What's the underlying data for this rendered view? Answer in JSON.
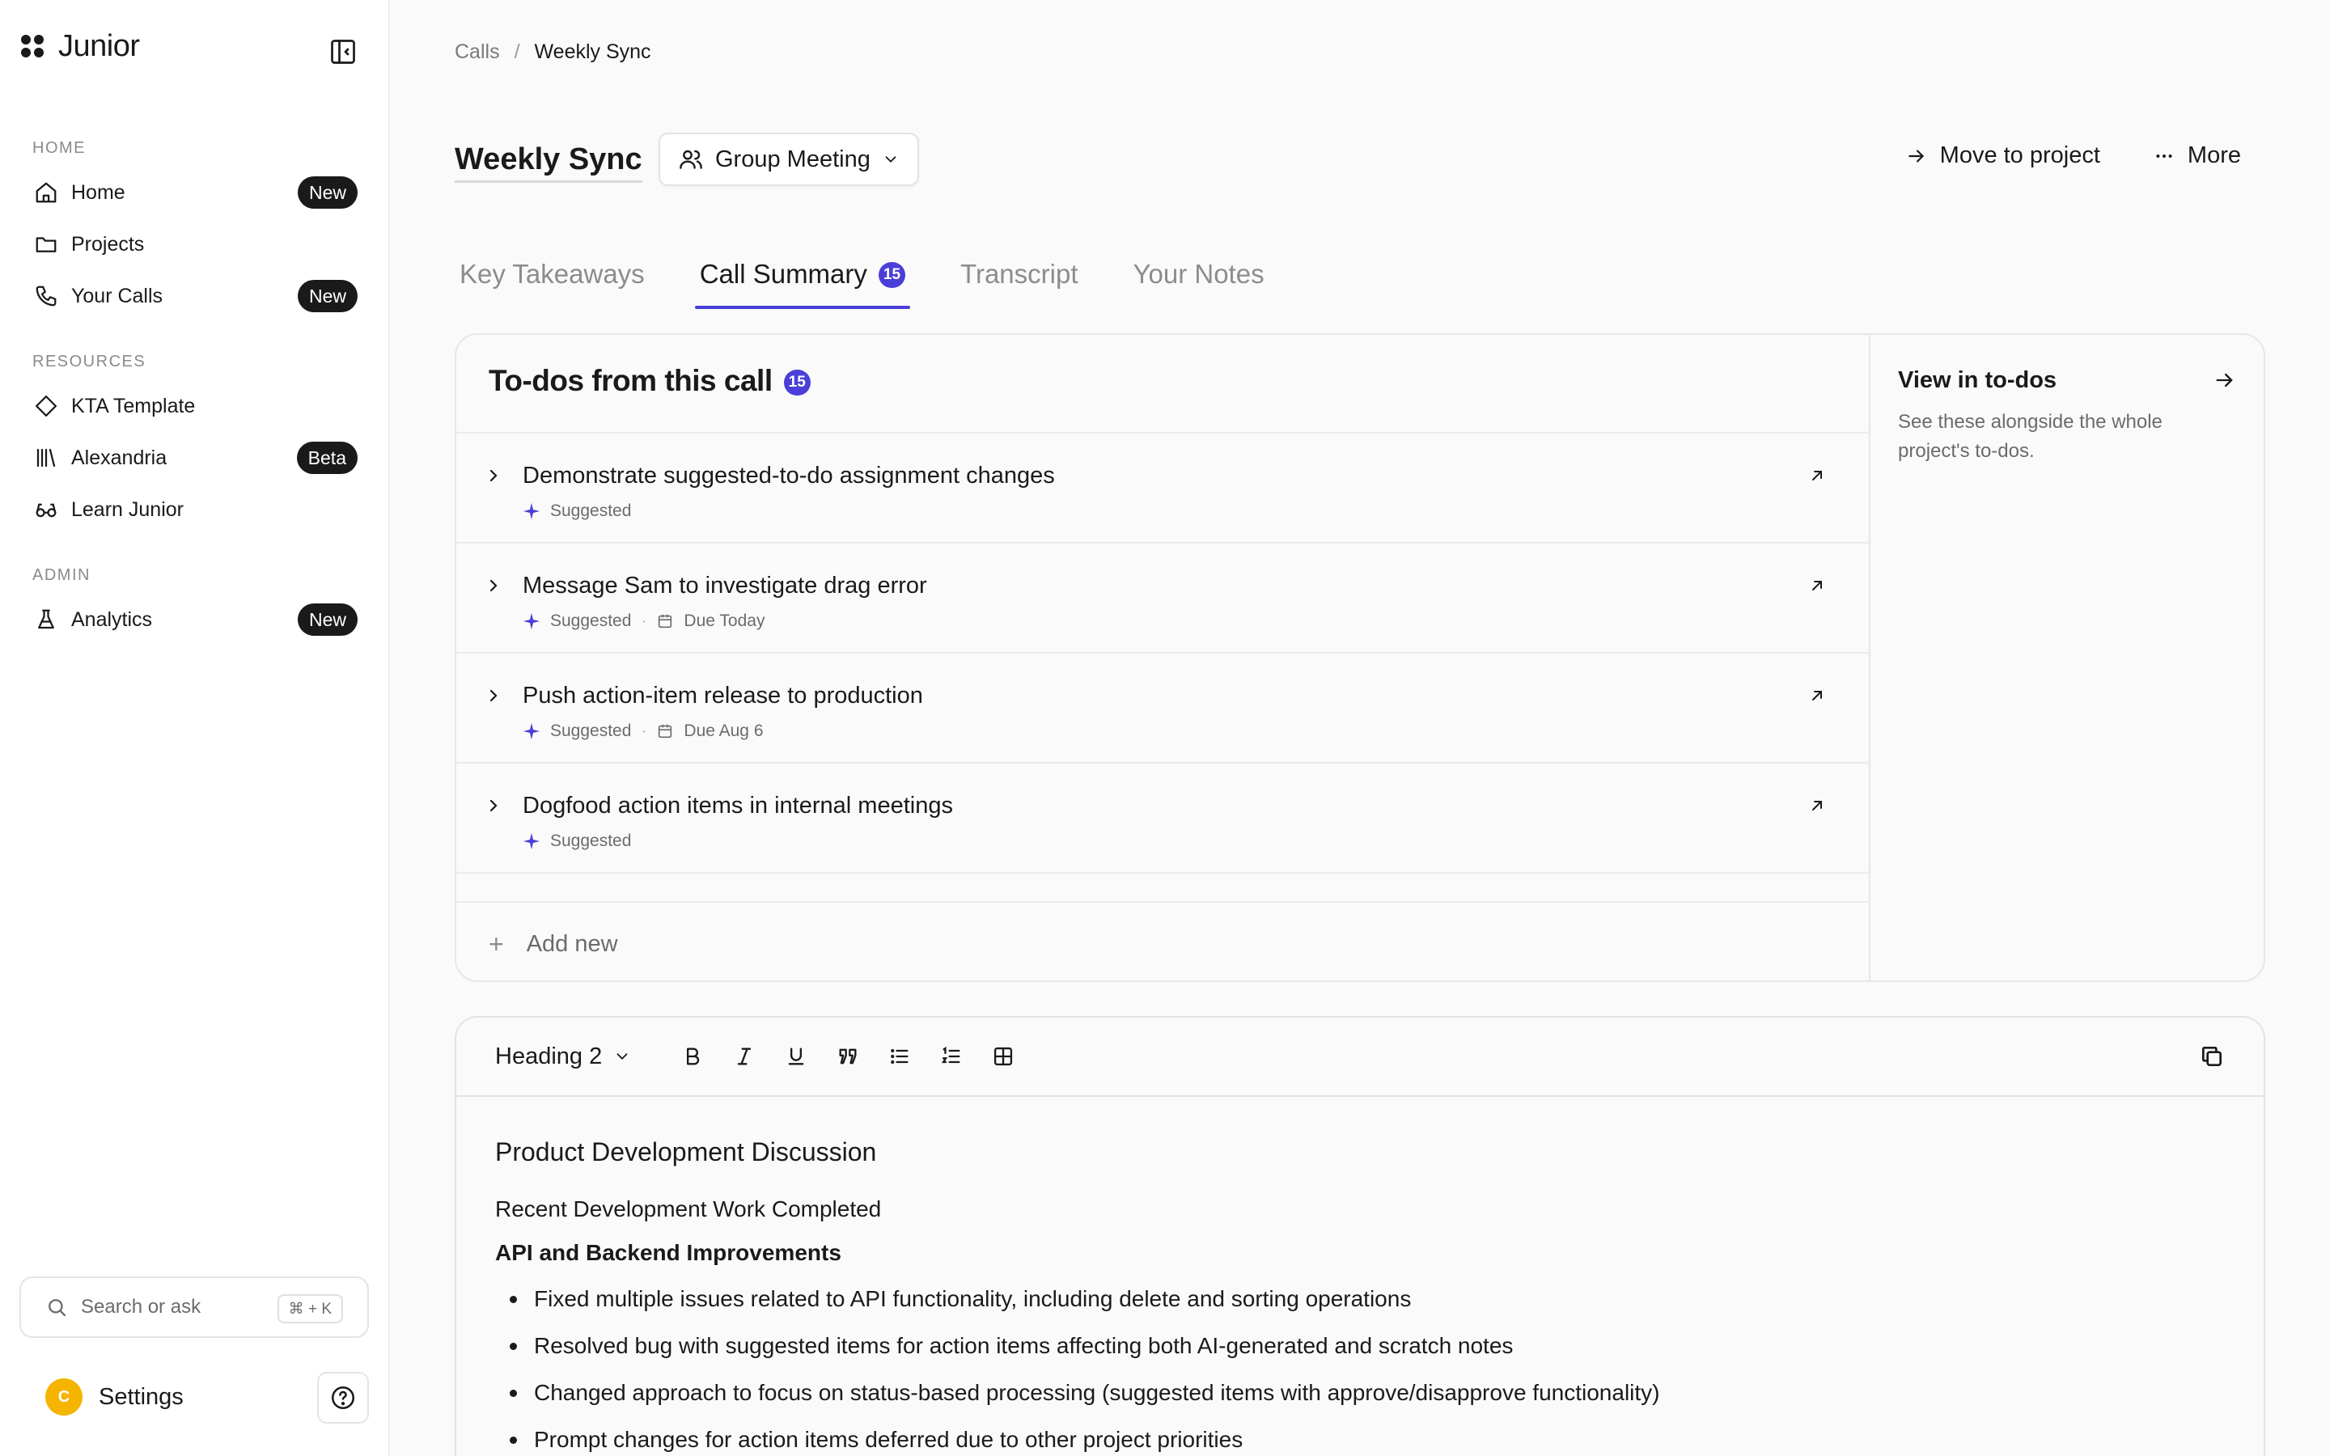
{
  "brand": {
    "name": "Junior"
  },
  "sidebar": {
    "sections": [
      {
        "label": "HOME",
        "items": [
          {
            "label": "Home",
            "icon": "home-icon",
            "badge": "New"
          },
          {
            "label": "Projects",
            "icon": "folder-icon",
            "badge": ""
          },
          {
            "label": "Your Calls",
            "icon": "phone-icon",
            "badge": "New"
          }
        ]
      },
      {
        "label": "RESOURCES",
        "items": [
          {
            "label": "KTA Template",
            "icon": "diamond-icon",
            "badge": ""
          },
          {
            "label": "Alexandria",
            "icon": "library-icon",
            "badge": "Beta"
          },
          {
            "label": "Learn Junior",
            "icon": "glasses-icon",
            "badge": ""
          }
        ]
      },
      {
        "label": "ADMIN",
        "items": [
          {
            "label": "Analytics",
            "icon": "flask-icon",
            "badge": "New"
          }
        ]
      }
    ],
    "search": {
      "placeholder": "Search or ask",
      "shortcut": "⌘ + K"
    },
    "user": {
      "initial": "C",
      "settings_label": "Settings"
    }
  },
  "breadcrumb": {
    "root": "Calls",
    "separator": "/",
    "current": "Weekly Sync"
  },
  "header": {
    "title": "Weekly Sync",
    "meeting_type": "Group Meeting",
    "move_label": "Move to project",
    "more_label": "More"
  },
  "tabs": [
    {
      "label": "Key Takeaways",
      "active": false,
      "count": ""
    },
    {
      "label": "Call Summary",
      "active": true,
      "count": "15"
    },
    {
      "label": "Transcript",
      "active": false,
      "count": ""
    },
    {
      "label": "Your Notes",
      "active": false,
      "count": ""
    }
  ],
  "todos": {
    "title": "To-dos from this call",
    "count": "15",
    "items": [
      {
        "title": "Demonstrate suggested-to-do assignment changes",
        "status": "Suggested",
        "due": ""
      },
      {
        "title": "Message Sam to investigate drag error",
        "status": "Suggested",
        "due": "Due Today"
      },
      {
        "title": "Push action-item release to production",
        "status": "Suggested",
        "due": "Due Aug 6"
      },
      {
        "title": "Dogfood action items in internal meetings",
        "status": "Suggested",
        "due": ""
      }
    ],
    "add_label": "Add new",
    "view_panel": {
      "title": "View in to-dos",
      "description": "See these alongside the whole project's to-dos."
    }
  },
  "editor": {
    "block_style": "Heading 2",
    "content": {
      "heading": "Product Development Discussion",
      "paragraph": "Recent Development Work Completed",
      "subheading": "API and Backend Improvements",
      "bullets": [
        "Fixed multiple issues related to API functionality, including delete and sorting operations",
        "Resolved bug with suggested items for action items affecting both AI-generated and scratch notes",
        "Changed approach to focus on status-based processing (suggested items with approve/disapprove functionality)",
        "Prompt changes for action items deferred due to other project priorities"
      ]
    }
  },
  "colors": {
    "accent": "#4b3fd8",
    "badge_bg": "#1a1a1a",
    "avatar": "#f5b400"
  }
}
